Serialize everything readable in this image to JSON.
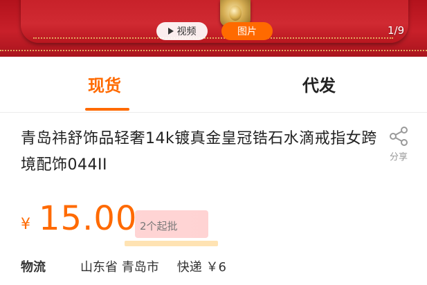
{
  "media": {
    "video_label": "视频",
    "image_label": "图片",
    "counter": "1/9"
  },
  "tabs": [
    {
      "label": "现货",
      "active": true
    },
    {
      "label": "代发",
      "active": false
    }
  ],
  "product": {
    "title": "青岛祎舒饰品轻奢14k镀真金皇冠锆石水滴戒指女跨境配饰044II",
    "currency": "¥",
    "price": "15.00",
    "min_order": "2个起批"
  },
  "share": {
    "label": "分享",
    "icon": "share-icon"
  },
  "logistics": {
    "label": "物流",
    "location": "山东省 青岛市",
    "shipping": "快递 ￥6"
  },
  "colors": {
    "accent": "#ff6a00",
    "hero_red": "#c8202a"
  }
}
